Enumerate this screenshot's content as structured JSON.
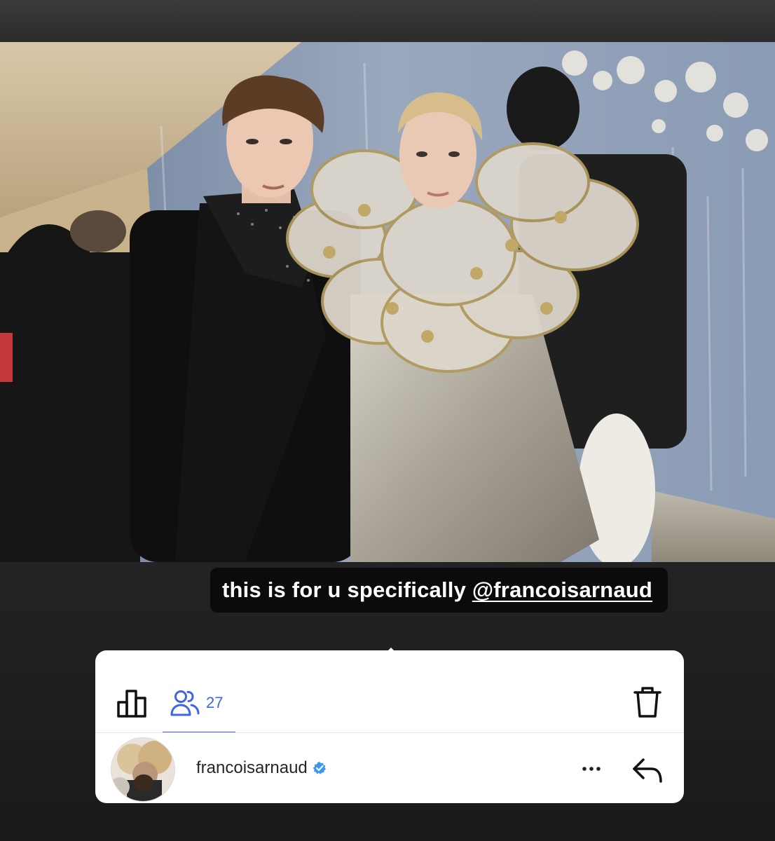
{
  "story": {
    "photo": {
      "alt": "",
      "icon": "red-carpet-photo"
    },
    "caption": {
      "text": "this is for u specifically ",
      "mention": "@francoisarnaud"
    }
  },
  "viewer_sheet": {
    "stats_icon": "bar-chart-icon",
    "viewers_icon": "people-icon",
    "viewers_count": "27",
    "delete_icon": "trash-icon",
    "viewer": {
      "username": "francoisarnaud",
      "verified": true,
      "more_icon": "more-horizontal-icon",
      "reply_icon": "reply-arrow-icon"
    },
    "colors": {
      "accent": "#3d66e0",
      "verified": "#3897f0"
    }
  }
}
